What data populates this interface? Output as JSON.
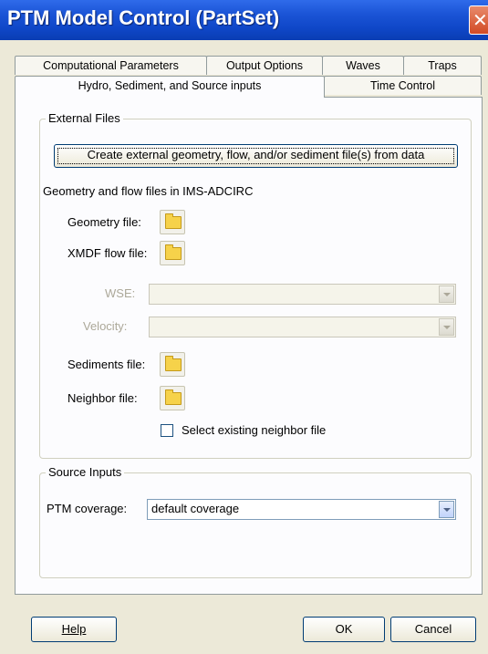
{
  "window": {
    "title": "PTM Model Control (PartSet)",
    "close_glyph": "✕"
  },
  "tabs": {
    "row1": [
      "Computational Parameters",
      "Output Options",
      "Waves",
      "Traps"
    ],
    "row2": [
      "Hydro, Sediment, and Source inputs",
      "Time Control"
    ],
    "active": "Hydro, Sediment, and Source inputs"
  },
  "external_files": {
    "legend": "External Files",
    "create_button": "Create external geometry, flow, and/or sediment file(s) from data",
    "section_label": "Geometry and flow files in IMS-ADCIRC",
    "geometry_label": "Geometry file:",
    "xmdf_label": "XMDF flow file:",
    "wse_label": "WSE:",
    "velocity_label": "Velocity:",
    "sediments_label": "Sediments file:",
    "neighbor_label": "Neighbor file:",
    "neighbor_checkbox_label": "Select existing neighbor file",
    "folder_icon": "folder-icon"
  },
  "source_inputs": {
    "legend": "Source Inputs",
    "ptm_coverage_label": "PTM coverage:",
    "ptm_coverage_value": "default coverage"
  },
  "buttons": {
    "help": "Help",
    "ok": "OK",
    "cancel": "Cancel"
  }
}
